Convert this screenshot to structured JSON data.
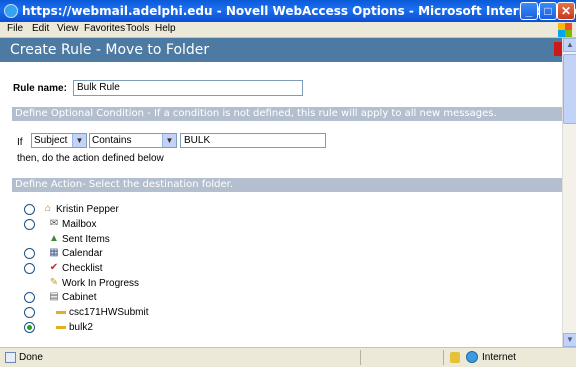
{
  "window": {
    "title": "https://webmail.adelphi.edu - Novell WebAccess Options - Microsoft Internet Explorer",
    "minimize": "_",
    "maximize": "□",
    "close": "✕"
  },
  "menu": [
    "File",
    "Edit",
    "View",
    "Favorites",
    "Tools",
    "Help"
  ],
  "page": {
    "title": "Create Rule - Move to Folder"
  },
  "rule": {
    "label": "Rule name:",
    "value": "Bulk Rule"
  },
  "condition": {
    "header": "Define Optional Condition - If a condition is not defined, this rule will apply to all new messages.",
    "if_label": "If",
    "field_select": "Subject",
    "operator_select": "Contains",
    "value": "BULK",
    "then_text": "then, do the action defined below"
  },
  "action": {
    "header": "Define Action- Select the destination folder.",
    "folders": [
      {
        "label": "Kristin Pepper",
        "icon": "home-icon",
        "has_radio": true,
        "selected": false
      },
      {
        "label": "Mailbox",
        "icon": "mailbox-icon",
        "has_radio": true,
        "selected": false
      },
      {
        "label": "Sent Items",
        "icon": "sent-items-icon",
        "has_radio": false,
        "selected": false
      },
      {
        "label": "Calendar",
        "icon": "calendar-icon",
        "has_radio": true,
        "selected": false
      },
      {
        "label": "Checklist",
        "icon": "checklist-icon",
        "has_radio": true,
        "selected": false
      },
      {
        "label": "Work In Progress",
        "icon": "work-in-progress-icon",
        "has_radio": false,
        "selected": false
      },
      {
        "label": "Cabinet",
        "icon": "cabinet-icon",
        "has_radio": true,
        "selected": false
      },
      {
        "label": "csc171HWSubmit",
        "icon": "folder-icon",
        "has_radio": true,
        "selected": false
      },
      {
        "label": "bulk2",
        "icon": "folder-icon",
        "has_radio": true,
        "selected": true
      }
    ]
  },
  "status": {
    "text": "Done",
    "zone": "Internet"
  },
  "colors": {
    "titlebar": "#0a5ad8",
    "page_header": "#4d7aa3",
    "section_bar": "#b3bfcf",
    "radio_selected": "#21a121"
  }
}
